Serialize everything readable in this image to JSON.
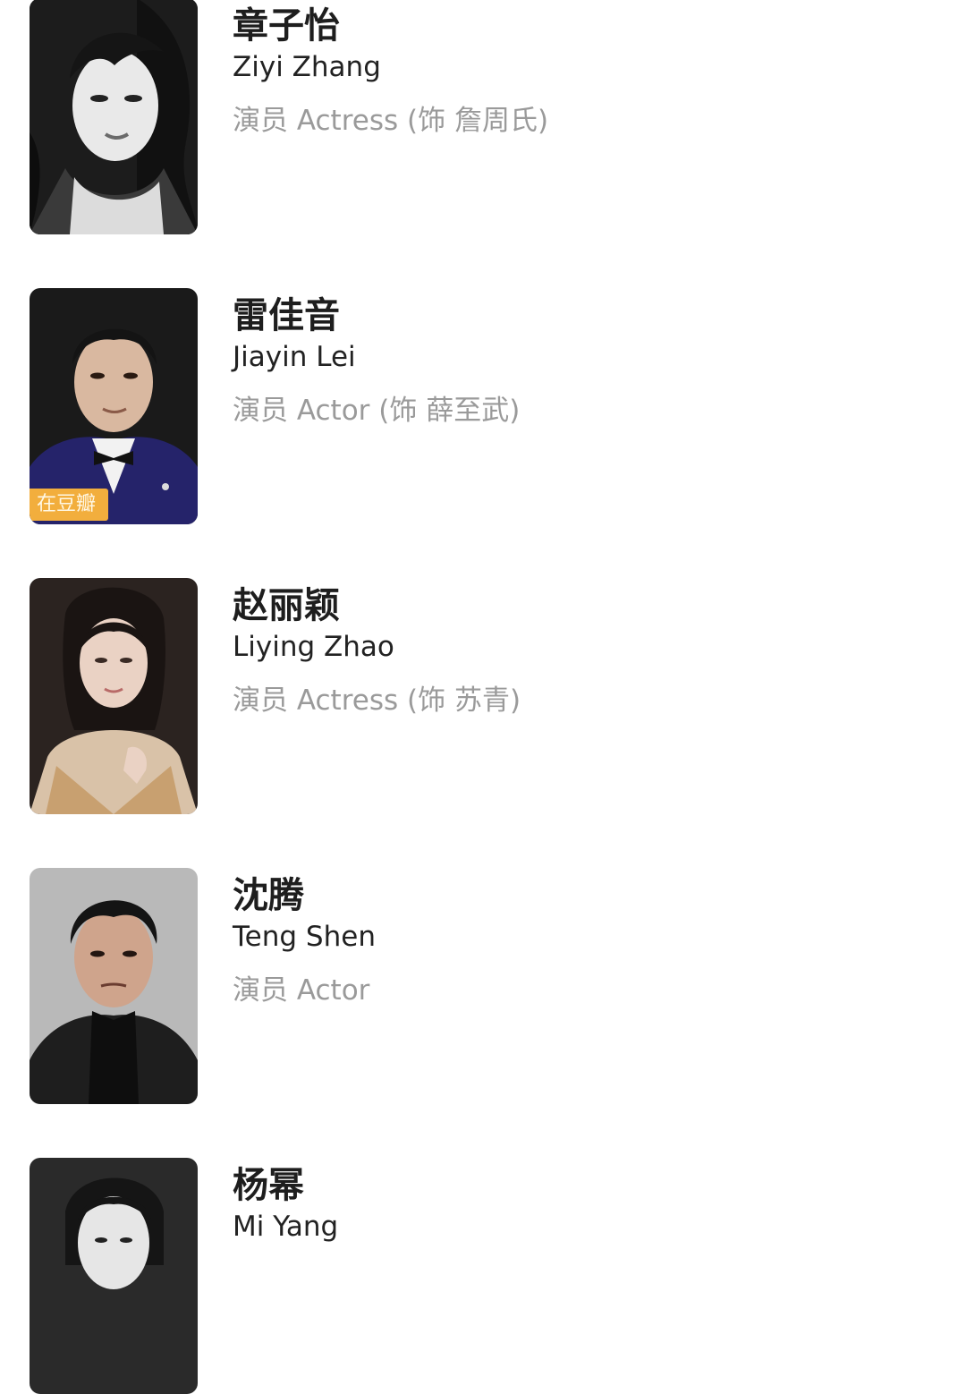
{
  "cast": [
    {
      "name_cn": "章子怡",
      "name_en": "Ziyi Zhang",
      "role": "演员 Actress (饰 詹周氏)",
      "photo_icon": "portrait-photo-woman-bw",
      "badge": null
    },
    {
      "name_cn": "雷佳音",
      "name_en": "Jiayin Lei",
      "role": "演员 Actor (饰 薛至武)",
      "photo_icon": "portrait-photo-man-tuxedo",
      "badge": "在豆瓣"
    },
    {
      "name_cn": "赵丽颖",
      "name_en": "Liying Zhao",
      "role": "演员 Actress (饰 苏青)",
      "photo_icon": "portrait-photo-woman-gold-dress",
      "badge": null
    },
    {
      "name_cn": "沈腾",
      "name_en": "Teng Shen",
      "role": "演员 Actor",
      "photo_icon": "portrait-photo-man-dark-suit",
      "badge": null
    },
    {
      "name_cn": "杨幂",
      "name_en": "Mi Yang",
      "role": "",
      "photo_icon": "portrait-photo-woman-bw",
      "badge": null
    }
  ],
  "colors": {
    "name_cn": "#1e1e1e",
    "name_en": "#222222",
    "role": "#9a9a9a",
    "badge_bg": "#f2ae3d"
  }
}
